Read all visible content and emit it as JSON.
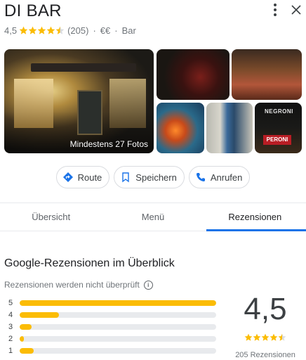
{
  "place": {
    "name": "DI BAR",
    "rating": "4,5",
    "rating_value": 4.5,
    "review_count": "(205)",
    "price": "€€",
    "category": "Bar",
    "separator": "·"
  },
  "photos": {
    "caption": "Mindestens 27 Fotos",
    "sign_text": "NEGRONI",
    "beer_text": "PERONI"
  },
  "actions": [
    {
      "label": "Route",
      "icon": "directions-icon"
    },
    {
      "label": "Speichern",
      "icon": "bookmark-icon"
    },
    {
      "label": "Anrufen",
      "icon": "phone-icon"
    }
  ],
  "tabs": [
    {
      "label": "Übersicht",
      "active": false
    },
    {
      "label": "Menü",
      "active": false
    },
    {
      "label": "Rezensionen",
      "active": true
    }
  ],
  "reviews": {
    "title": "Google-Rezensionen im Überblick",
    "note": "Rezensionen werden nicht überprüft",
    "info_glyph": "i",
    "big_rating": "4,5",
    "count_label": "205 Rezensionen",
    "distribution": [
      {
        "stars": "5",
        "fraction": 1.0
      },
      {
        "stars": "4",
        "fraction": 0.2
      },
      {
        "stars": "3",
        "fraction": 0.06
      },
      {
        "stars": "2",
        "fraction": 0.02
      },
      {
        "stars": "1",
        "fraction": 0.07
      }
    ]
  },
  "colors": {
    "accent": "#1a73e8",
    "star": "#fbbc04",
    "star_empty": "#dadce0",
    "bar_track": "#e8eaed"
  }
}
